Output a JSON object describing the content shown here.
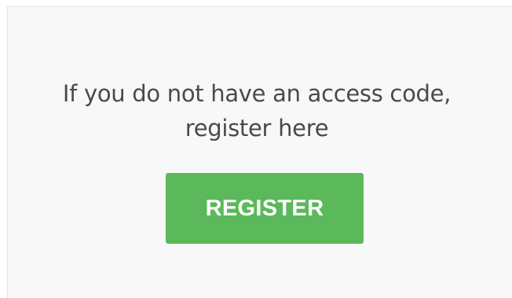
{
  "register_panel": {
    "prompt_line1": "If you do not have an access code,",
    "prompt_line2": "register here",
    "register_button_label": "REGISTER",
    "accent_color": "#5bb85b",
    "background_color": "#f8f8f8",
    "text_color": "#4a4a4a"
  }
}
